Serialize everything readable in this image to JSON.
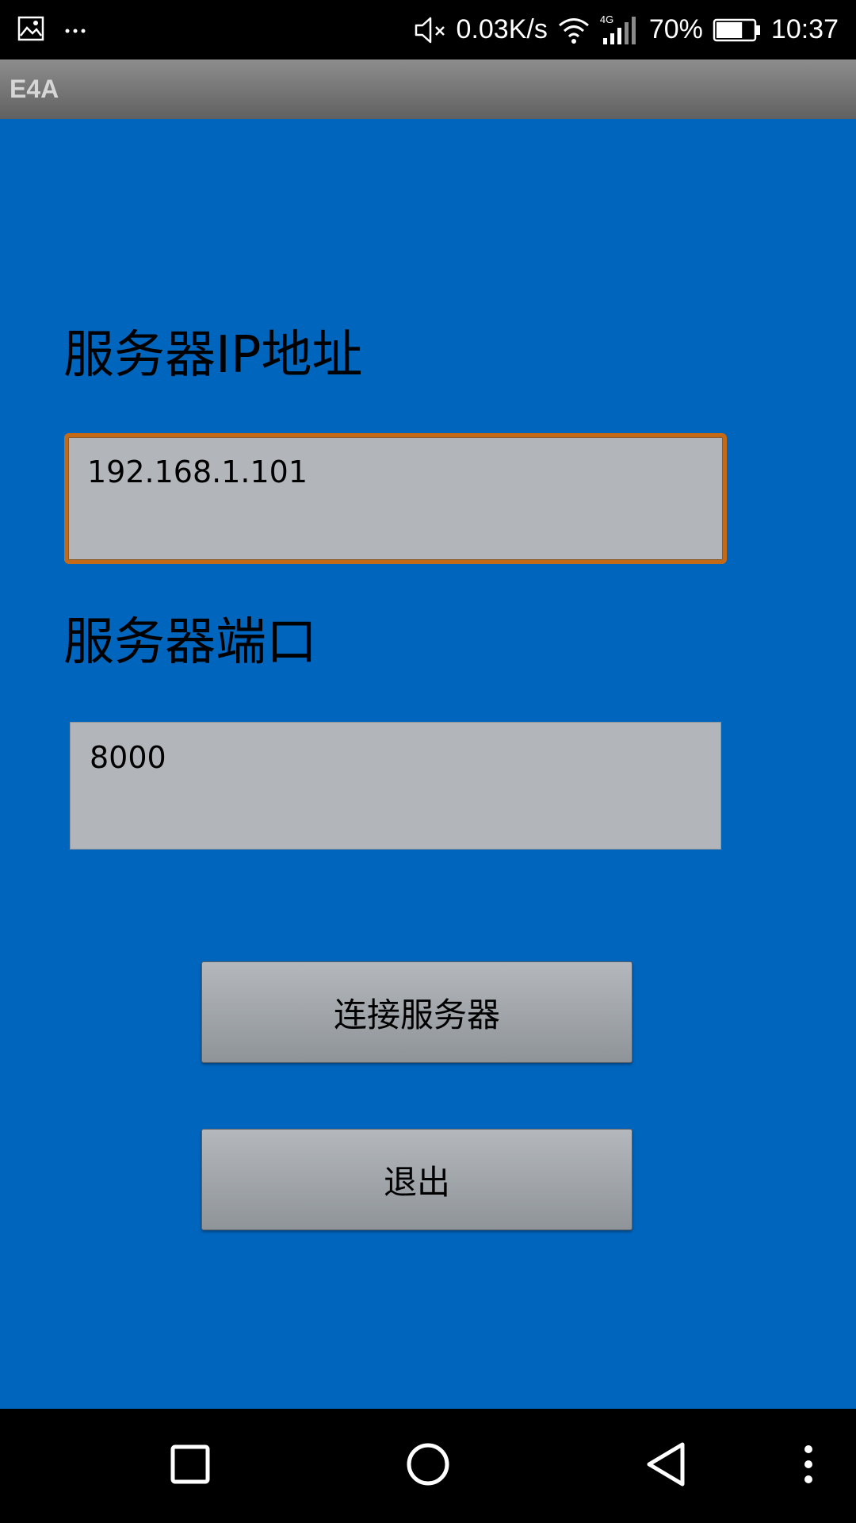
{
  "status_bar": {
    "left_icons": [
      "image-icon",
      "more-dots-icon"
    ],
    "network_speed": "0.03K/s",
    "network_type": "4G",
    "battery": "70%",
    "battery_level": 0.7,
    "time": "10:37"
  },
  "app": {
    "title": "E4A"
  },
  "form": {
    "ip_label": "服务器IP地址",
    "ip_value": "192.168.1.101",
    "port_label": "服务器端口",
    "port_value": "8000"
  },
  "buttons": {
    "connect_label": "连接服务器",
    "exit_label": "退出"
  },
  "navigation": {
    "icons": [
      "recent-apps-icon",
      "home-icon",
      "back-icon",
      "menu-icon"
    ]
  },
  "colors": {
    "background": "#0065bd",
    "focus_border": "#c46a17",
    "field_background": "#b2b6ba"
  }
}
